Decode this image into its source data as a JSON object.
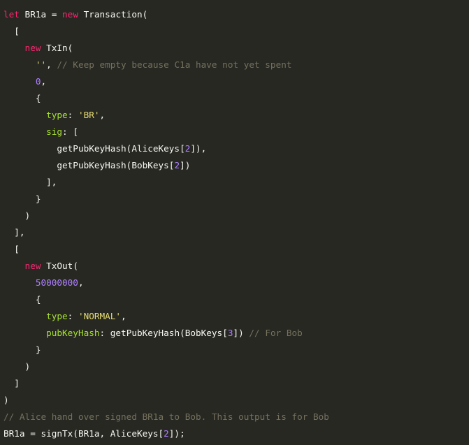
{
  "code": {
    "lines": [
      [
        {
          "t": "kw",
          "v": "let"
        },
        {
          "t": "id",
          "v": " BR1a "
        },
        {
          "t": "punc",
          "v": "= "
        },
        {
          "t": "kw",
          "v": "new"
        },
        {
          "t": "id",
          "v": " Transaction("
        }
      ],
      [
        {
          "t": "punc",
          "v": "  ["
        }
      ],
      [
        {
          "t": "kw",
          "v": "    new"
        },
        {
          "t": "id",
          "v": " TxIn("
        }
      ],
      [
        {
          "t": "str",
          "v": "      ''"
        },
        {
          "t": "punc",
          "v": ", "
        },
        {
          "t": "cmt",
          "v": "// Keep empty because C1a have not yet spent"
        }
      ],
      [
        {
          "t": "num",
          "v": "      0"
        },
        {
          "t": "punc",
          "v": ","
        }
      ],
      [
        {
          "t": "punc",
          "v": "      {"
        }
      ],
      [
        {
          "t": "prop",
          "v": "        type"
        },
        {
          "t": "punc",
          "v": ": "
        },
        {
          "t": "str",
          "v": "'BR'"
        },
        {
          "t": "punc",
          "v": ","
        }
      ],
      [
        {
          "t": "prop",
          "v": "        sig"
        },
        {
          "t": "punc",
          "v": ": ["
        }
      ],
      [
        {
          "t": "id",
          "v": "          getPubKeyHash(AliceKeys["
        },
        {
          "t": "num",
          "v": "2"
        },
        {
          "t": "id",
          "v": "]),"
        }
      ],
      [
        {
          "t": "id",
          "v": "          getPubKeyHash(BobKeys["
        },
        {
          "t": "num",
          "v": "2"
        },
        {
          "t": "id",
          "v": "])"
        }
      ],
      [
        {
          "t": "punc",
          "v": "        ],"
        }
      ],
      [
        {
          "t": "punc",
          "v": "      }"
        }
      ],
      [
        {
          "t": "punc",
          "v": "    )"
        }
      ],
      [
        {
          "t": "punc",
          "v": "  ],"
        }
      ],
      [
        {
          "t": "punc",
          "v": "  ["
        }
      ],
      [
        {
          "t": "kw",
          "v": "    new"
        },
        {
          "t": "id",
          "v": " TxOut("
        }
      ],
      [
        {
          "t": "num",
          "v": "      50000000"
        },
        {
          "t": "punc",
          "v": ","
        }
      ],
      [
        {
          "t": "punc",
          "v": "      {"
        }
      ],
      [
        {
          "t": "prop",
          "v": "        type"
        },
        {
          "t": "punc",
          "v": ": "
        },
        {
          "t": "str",
          "v": "'NORMAL'"
        },
        {
          "t": "punc",
          "v": ","
        }
      ],
      [
        {
          "t": "prop",
          "v": "        pubKeyHash"
        },
        {
          "t": "punc",
          "v": ": "
        },
        {
          "t": "id",
          "v": "getPubKeyHash(BobKeys["
        },
        {
          "t": "num",
          "v": "3"
        },
        {
          "t": "id",
          "v": "]) "
        },
        {
          "t": "cmt",
          "v": "// For Bob"
        }
      ],
      [
        {
          "t": "punc",
          "v": "      }"
        }
      ],
      [
        {
          "t": "punc",
          "v": "    )"
        }
      ],
      [
        {
          "t": "punc",
          "v": "  ]"
        }
      ],
      [
        {
          "t": "punc",
          "v": ")"
        }
      ],
      [
        {
          "t": "cmt",
          "v": "// Alice hand over signed BR1a to Bob. This output is for Bob"
        }
      ],
      [
        {
          "t": "id",
          "v": "BR1a = signTx(BR1a, AliceKeys["
        },
        {
          "t": "num",
          "v": "2"
        },
        {
          "t": "id",
          "v": "]);"
        }
      ]
    ]
  }
}
